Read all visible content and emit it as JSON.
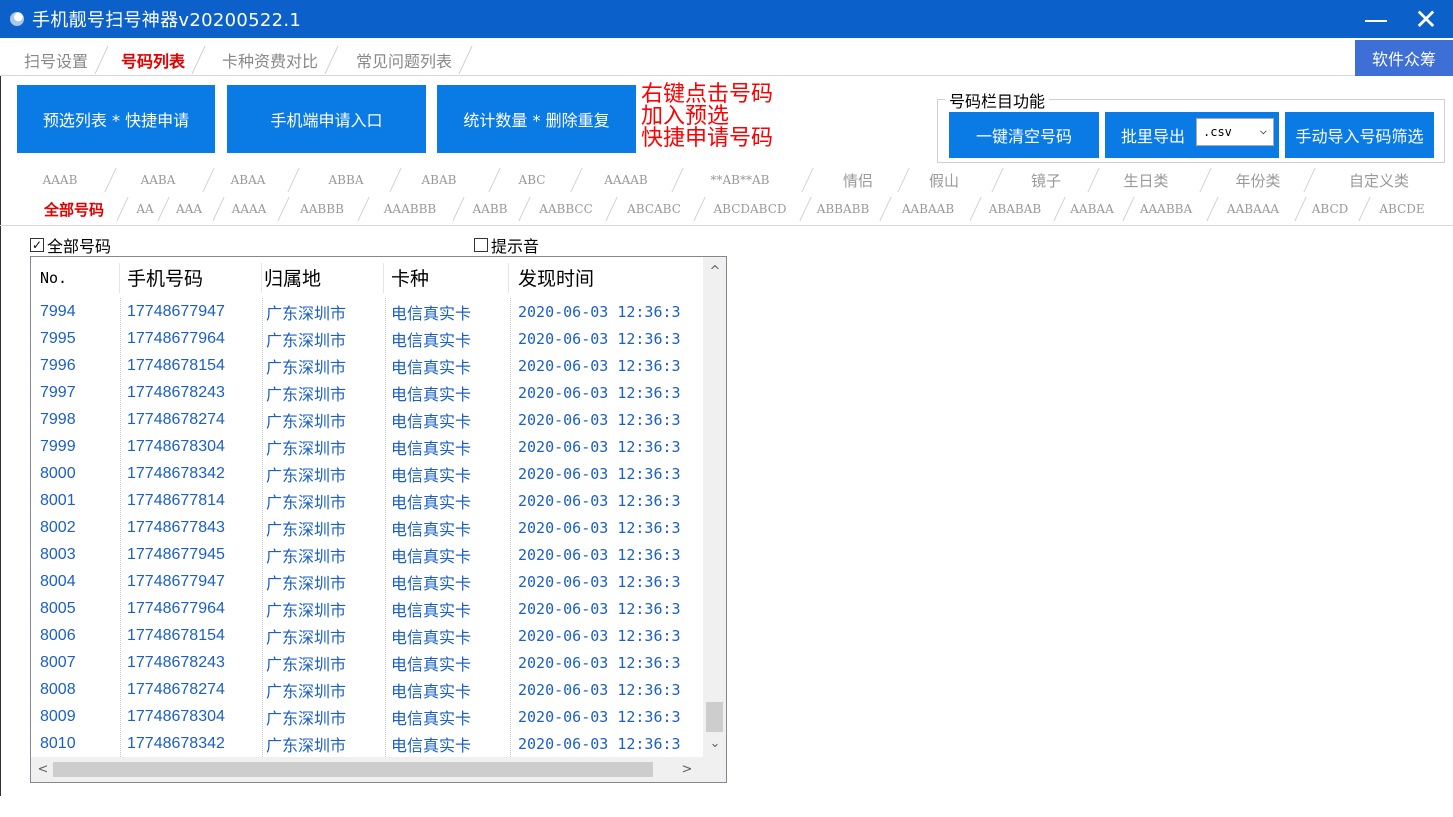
{
  "window": {
    "title": "手机靓号扫号神器v20200522.1",
    "minimize_glyph": "—",
    "close_glyph": "✕"
  },
  "main_tabs": [
    {
      "label": "扫号设置",
      "active": false
    },
    {
      "label": "号码列表",
      "active": true
    },
    {
      "label": "卡种资费对比",
      "active": false
    },
    {
      "label": "常见问题列表",
      "active": false
    }
  ],
  "support_button": "软件众筹",
  "buttons": {
    "preselect": "预选列表 * 快捷申请",
    "mobile_apply": "手机端申请入口",
    "stats_dedupe": "统计数量 * 删除重复"
  },
  "hint": {
    "line1": "右键点击号码",
    "line2": "加入预选",
    "line3": "快捷申请号码"
  },
  "number_column": {
    "title": "号码栏目功能",
    "clear_all": "一键清空号码",
    "batch_export": "批里导出",
    "export_format": ".csv",
    "manual_import": "手动导入号码筛选"
  },
  "category_row1": [
    "AAAB",
    "AABA",
    "ABAA",
    "ABBA",
    "ABAB",
    "ABC",
    "AAAAB",
    "**AB**AB",
    "情侣",
    "假山",
    "镜子",
    "生日类",
    "年份类",
    "自定义类"
  ],
  "category_row2": [
    "全部号码",
    "AA",
    "AAA",
    "AAAA",
    "AABBB",
    "AAABBB",
    "AABB",
    "AABBCC",
    "ABCABC",
    "ABCDABCD",
    "ABBABB",
    "AABAAB",
    "ABABAB",
    "AABAA",
    "AAABBA",
    "AABAAA",
    "ABCD",
    "ABCDE"
  ],
  "active_category": "全部号码",
  "checkboxes": {
    "all_numbers": {
      "label": "全部号码",
      "checked": true,
      "mark": "✓"
    },
    "sound": {
      "label": "提示音",
      "checked": false
    }
  },
  "table": {
    "columns": [
      "No.",
      "手机号码",
      "归属地",
      "卡种",
      "发现时间"
    ],
    "rows": [
      [
        "7994",
        "17748677947",
        "广东深圳市",
        "电信真实卡",
        "2020-06-03 12:36:3"
      ],
      [
        "7995",
        "17748677964",
        "广东深圳市",
        "电信真实卡",
        "2020-06-03 12:36:3"
      ],
      [
        "7996",
        "17748678154",
        "广东深圳市",
        "电信真实卡",
        "2020-06-03 12:36:3"
      ],
      [
        "7997",
        "17748678243",
        "广东深圳市",
        "电信真实卡",
        "2020-06-03 12:36:3"
      ],
      [
        "7998",
        "17748678274",
        "广东深圳市",
        "电信真实卡",
        "2020-06-03 12:36:3"
      ],
      [
        "7999",
        "17748678304",
        "广东深圳市",
        "电信真实卡",
        "2020-06-03 12:36:3"
      ],
      [
        "8000",
        "17748678342",
        "广东深圳市",
        "电信真实卡",
        "2020-06-03 12:36:3"
      ],
      [
        "8001",
        "17748677814",
        "广东深圳市",
        "电信真实卡",
        "2020-06-03 12:36:3"
      ],
      [
        "8002",
        "17748677843",
        "广东深圳市",
        "电信真实卡",
        "2020-06-03 12:36:3"
      ],
      [
        "8003",
        "17748677945",
        "广东深圳市",
        "电信真实卡",
        "2020-06-03 12:36:3"
      ],
      [
        "8004",
        "17748677947",
        "广东深圳市",
        "电信真实卡",
        "2020-06-03 12:36:3"
      ],
      [
        "8005",
        "17748677964",
        "广东深圳市",
        "电信真实卡",
        "2020-06-03 12:36:3"
      ],
      [
        "8006",
        "17748678154",
        "广东深圳市",
        "电信真实卡",
        "2020-06-03 12:36:3"
      ],
      [
        "8007",
        "17748678243",
        "广东深圳市",
        "电信真实卡",
        "2020-06-03 12:36:3"
      ],
      [
        "8008",
        "17748678274",
        "广东深圳市",
        "电信真实卡",
        "2020-06-03 12:36:3"
      ],
      [
        "8009",
        "17748678304",
        "广东深圳市",
        "电信真实卡",
        "2020-06-03 12:36:3"
      ],
      [
        "8010",
        "17748678342",
        "广东深圳市",
        "电信真实卡",
        "2020-06-03 12:36:3"
      ]
    ]
  },
  "scroll": {
    "up": "^",
    "down": "⌄",
    "left": "<",
    "right": ">"
  },
  "colors": {
    "titlebar": "#0b61c9",
    "button": "#0a7ae4",
    "support": "#3d6fd6",
    "hint": "#ff0000",
    "active_tab": "#e00000",
    "row_text": "#1a5fc8"
  }
}
